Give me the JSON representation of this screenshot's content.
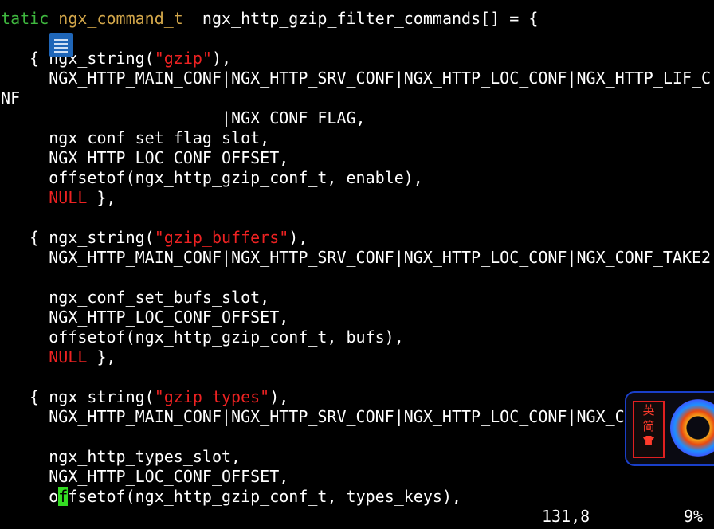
{
  "code_lines": [
    {
      "segments": [
        {
          "text": "static",
          "cls": "kw"
        },
        {
          "text": " ",
          "cls": ""
        },
        {
          "text": "ngx_command_t",
          "cls": "ty"
        },
        {
          "text": "  ngx_http_gzip_filter_commands[] = {",
          "cls": ""
        }
      ]
    },
    {
      "segments": []
    },
    {
      "segments": [
        {
          "text": "    { ngx_string(",
          "cls": ""
        },
        {
          "text": "\"gzip\"",
          "cls": "str"
        },
        {
          "text": "),",
          "cls": ""
        }
      ]
    },
    {
      "segments": [
        {
          "text": "      NGX_HTTP_MAIN_CONF|NGX_HTTP_SRV_CONF|NGX_HTTP_LOC_CONF|NGX_HTTP_LIF_C",
          "cls": ""
        }
      ]
    },
    {
      "segments": [
        {
          "text": "ONF",
          "cls": ""
        }
      ]
    },
    {
      "segments": [
        {
          "text": "                        |NGX_CONF_FLAG,",
          "cls": ""
        }
      ]
    },
    {
      "segments": [
        {
          "text": "      ngx_conf_set_flag_slot,",
          "cls": ""
        }
      ]
    },
    {
      "segments": [
        {
          "text": "      NGX_HTTP_LOC_CONF_OFFSET,",
          "cls": ""
        }
      ]
    },
    {
      "segments": [
        {
          "text": "      offsetof(ngx_http_gzip_conf_t, enable),",
          "cls": ""
        }
      ]
    },
    {
      "segments": [
        {
          "text": "      ",
          "cls": ""
        },
        {
          "text": "NULL",
          "cls": "null"
        },
        {
          "text": " },",
          "cls": ""
        }
      ]
    },
    {
      "segments": []
    },
    {
      "segments": [
        {
          "text": "    { ngx_string(",
          "cls": ""
        },
        {
          "text": "\"gzip_buffers\"",
          "cls": "str"
        },
        {
          "text": "),",
          "cls": ""
        }
      ]
    },
    {
      "segments": [
        {
          "text": "      NGX_HTTP_MAIN_CONF|NGX_HTTP_SRV_CONF|NGX_HTTP_LOC_CONF|NGX_CONF_TAKE2",
          "cls": ""
        }
      ]
    },
    {
      "segments": [
        {
          "text": ",",
          "cls": ""
        }
      ]
    },
    {
      "segments": [
        {
          "text": "      ngx_conf_set_bufs_slot,",
          "cls": ""
        }
      ]
    },
    {
      "segments": [
        {
          "text": "      NGX_HTTP_LOC_CONF_OFFSET,",
          "cls": ""
        }
      ]
    },
    {
      "segments": [
        {
          "text": "      offsetof(ngx_http_gzip_conf_t, bufs),",
          "cls": ""
        }
      ]
    },
    {
      "segments": [
        {
          "text": "      ",
          "cls": ""
        },
        {
          "text": "NULL",
          "cls": "null"
        },
        {
          "text": " },",
          "cls": ""
        }
      ]
    },
    {
      "segments": []
    },
    {
      "segments": [
        {
          "text": "    { ngx_string(",
          "cls": ""
        },
        {
          "text": "\"gzip_types\"",
          "cls": "str"
        },
        {
          "text": "),",
          "cls": ""
        }
      ]
    },
    {
      "segments": [
        {
          "text": "      NGX_HTTP_MAIN_CONF|NGX_HTTP_SRV_CONF|NGX_HTTP_LOC_CONF|NGX_C",
          "cls": ""
        }
      ]
    },
    {
      "segments": [
        {
          "text": ",",
          "cls": ""
        }
      ]
    },
    {
      "segments": [
        {
          "text": "      ngx_http_types_slot,",
          "cls": ""
        }
      ]
    },
    {
      "segments": [
        {
          "text": "      NGX_HTTP_LOC_CONF_OFFSET,",
          "cls": ""
        }
      ]
    },
    {
      "segments": [
        {
          "text": "      o",
          "cls": ""
        },
        {
          "text": "f",
          "cls": "cursor-cell"
        },
        {
          "text": "fsetof(ngx_http_gzip_conf_t, types_keys),",
          "cls": ""
        }
      ]
    }
  ],
  "status": {
    "cursor_position": "131,8",
    "scroll_percent": "9%"
  },
  "ime": {
    "language": "英",
    "mode": "简",
    "icon": "shirt-icon"
  },
  "overlay_icon": "document-icon",
  "colors": {
    "background": "#000000",
    "text": "#ffffff",
    "keyword": "#3fb83f",
    "type": "#d2a64a",
    "string": "#ee2222",
    "cursor": "#33dd22",
    "ime_accent": "#ff3b2b"
  }
}
